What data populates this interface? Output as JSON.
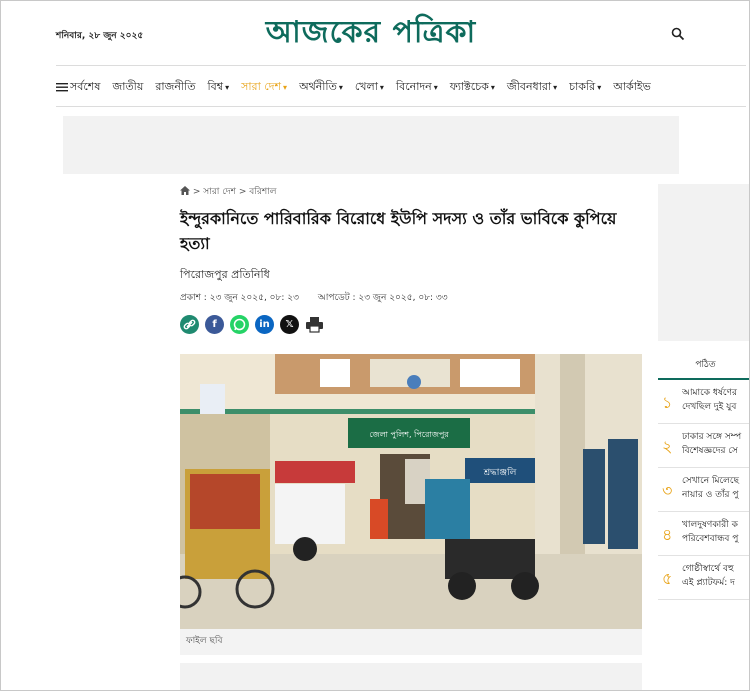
{
  "header": {
    "date": "শনিবার, ২৮ জুন ২০২৫",
    "logo": "আজকের পত্রিকা",
    "search_icon": "search-icon"
  },
  "nav": {
    "items": [
      {
        "label": "সর্বশেষ",
        "caret": false,
        "active": false
      },
      {
        "label": "জাতীয়",
        "caret": false,
        "active": false
      },
      {
        "label": "রাজনীতি",
        "caret": false,
        "active": false
      },
      {
        "label": "বিশ্ব",
        "caret": true,
        "active": false
      },
      {
        "label": "সারা দেশ",
        "caret": true,
        "active": true
      },
      {
        "label": "অর্থনীতি",
        "caret": true,
        "active": false
      },
      {
        "label": "খেলা",
        "caret": true,
        "active": false
      },
      {
        "label": "বিনোদন",
        "caret": true,
        "active": false
      },
      {
        "label": "ফ্যাক্টচেক",
        "caret": true,
        "active": false
      },
      {
        "label": "জীবনধারা",
        "caret": true,
        "active": false
      },
      {
        "label": "চাকরি",
        "caret": true,
        "active": false
      },
      {
        "label": "আর্কাইভ",
        "caret": false,
        "active": false
      }
    ]
  },
  "breadcrumb": {
    "home_icon": "home-icon",
    "section": "সারা দেশ",
    "subsection": "বরিশাল",
    "sep": ">"
  },
  "article": {
    "headline": "ইন্দুরকানিতে পারিবারিক বিরোধে ইউপি সদস্য ও তাঁর ভাবিকে কুপিয়ে হত্যা",
    "byline": "পিরোজপুর প্রতিনিধি",
    "published": "প্রকাশ : ২৩ জুন ২০২৫, ০৮: ২৩",
    "updated": "আপডেট : ২৩ জুন ২০২৫, ০৮: ৩৩",
    "photo_caption": "ফাইল ছবি",
    "photo_sign": "জেলা পুলিশ, পিরোজপুর",
    "photo_banner": "শ্রদ্ধাঞ্জলি"
  },
  "share": [
    {
      "icon": "link-icon",
      "color": "#1f8a70"
    },
    {
      "icon": "facebook-icon",
      "color": "#3b5998",
      "glyph": "f"
    },
    {
      "icon": "whatsapp-icon",
      "color": "#25d366"
    },
    {
      "icon": "linkedin-icon",
      "color": "#0a66c2",
      "glyph": "in"
    },
    {
      "icon": "x-icon",
      "color": "#111111",
      "glyph": "𝕏"
    },
    {
      "icon": "print-icon",
      "color": "#333333"
    }
  ],
  "sidebar": {
    "title": "পঠিত",
    "items": [
      {
        "num": "১",
        "line1": "আমাকে ধর্ষণের",
        "line2": "দেখছিল দুই যুব"
      },
      {
        "num": "২",
        "line1": "ঢাকার সঙ্গে সম্প",
        "line2": "বিশেষজ্ঞদের সে"
      },
      {
        "num": "৩",
        "line1": "সেখানে মিলেছে",
        "line2": "নায়ার ও তাঁর পু"
      },
      {
        "num": "৪",
        "line1": "খালদুষণকারী ক",
        "line2": "পরিবেশবান্ধব পু"
      },
      {
        "num": "৫",
        "line1": "গোষ্ঠীস্বার্থে বহু",
        "line2": "এই প্ল্যাটফর্ম: দ"
      }
    ]
  },
  "colors": {
    "brand": "#0e6b5c",
    "accent": "#e8a317"
  }
}
